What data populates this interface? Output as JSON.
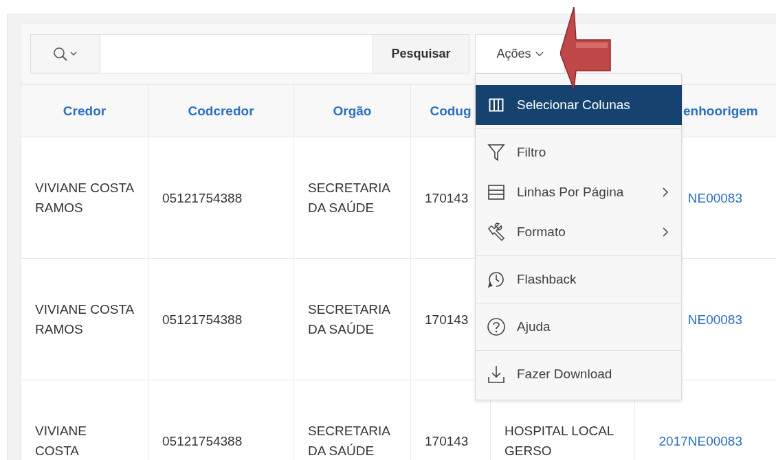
{
  "toolbar": {
    "search_button": "Pesquisar",
    "actions_button": "Ações"
  },
  "table": {
    "columns": [
      {
        "label": "Credor"
      },
      {
        "label": "Codcredor"
      },
      {
        "label": "Orgão"
      },
      {
        "label": "Codug"
      },
      {},
      {
        "label": "enhoorigem"
      }
    ],
    "rows": [
      {
        "column_1": "VIVIANE COSTA RAMOS",
        "column_2": "05121754388",
        "column_3": "SECRETARIA DA SAÚDE",
        "column_4": "170143",
        "column_6": "NE00083"
      },
      {
        "column_1": "VIVIANE COSTA RAMOS",
        "column_2": "05121754388",
        "column_3": "SECRETARIA DA SAÚDE",
        "column_4": "170143",
        "column_6": "NE00083"
      },
      {
        "column_1": "VIVIANE COSTA",
        "column_2": "05121754388",
        "column_3": "SECRETARIA DA SAÚDE",
        "column_4": "170143",
        "column_5": "HOSPITAL LOCAL GERSO",
        "column_6": "2017NE00083"
      }
    ]
  },
  "menu": {
    "groups": [
      [
        {
          "label": "Selecionar Colunas",
          "kind": "columns",
          "submenu": false,
          "selected": true
        }
      ],
      [
        {
          "label": "Filtro",
          "kind": "filter",
          "submenu": false,
          "selected": false
        },
        {
          "label": "Linhas Por Página",
          "kind": "rows",
          "submenu": true,
          "selected": false
        },
        {
          "label": "Formato",
          "kind": "format",
          "submenu": true,
          "selected": false
        }
      ],
      [
        {
          "label": "Flashback",
          "kind": "flashback",
          "submenu": false,
          "selected": false
        }
      ],
      [
        {
          "label": "Ajuda",
          "kind": "help",
          "submenu": false,
          "selected": false
        }
      ],
      [
        {
          "label": "Fazer Download",
          "kind": "download",
          "submenu": false,
          "selected": false
        }
      ]
    ]
  }
}
